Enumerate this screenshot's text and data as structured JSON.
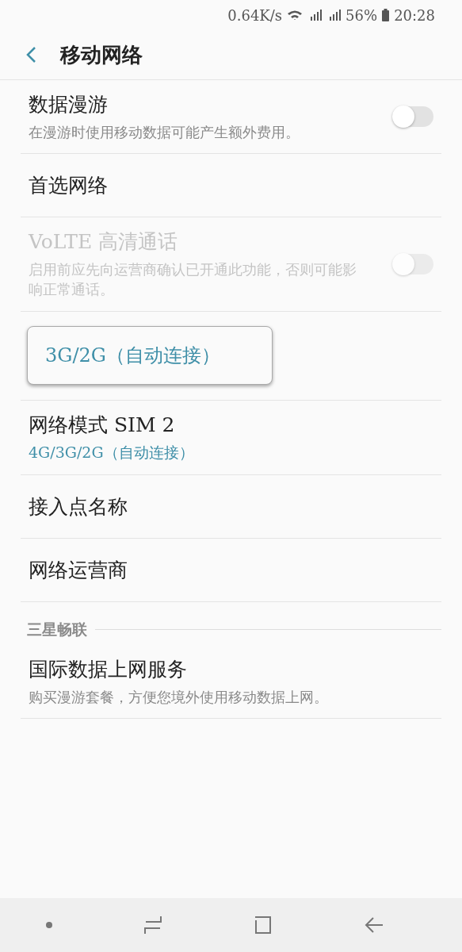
{
  "status_bar": {
    "speed": "0.64K/s",
    "battery": "56%",
    "time": "20:28"
  },
  "title": "移动网络",
  "items": [
    {
      "kind": "toggle",
      "title": "数据漫游",
      "subtitle": "在漫游时使用移动数据可能产生额外费用。",
      "on": false,
      "disabled": false
    },
    {
      "kind": "plain",
      "title": "首选网络"
    },
    {
      "kind": "toggle",
      "title": "VoLTE 高清通话",
      "subtitle": "启用前应先向运营商确认已开通此功能，否则可能影响正常通话。",
      "on": false,
      "disabled": true
    },
    {
      "kind": "popup",
      "option": "3G/2G（自动连接）"
    },
    {
      "kind": "value",
      "title": "网络模式 SIM 2",
      "value": "4G/3G/2G（自动连接）"
    },
    {
      "kind": "plain",
      "title": "接入点名称"
    },
    {
      "kind": "plain",
      "title": "网络运营商"
    },
    {
      "kind": "header",
      "title": "三星畅联"
    },
    {
      "kind": "subtitle",
      "title": "国际数据上网服务",
      "subtitle": "购买漫游套餐，方便您境外使用移动数据上网。"
    }
  ]
}
